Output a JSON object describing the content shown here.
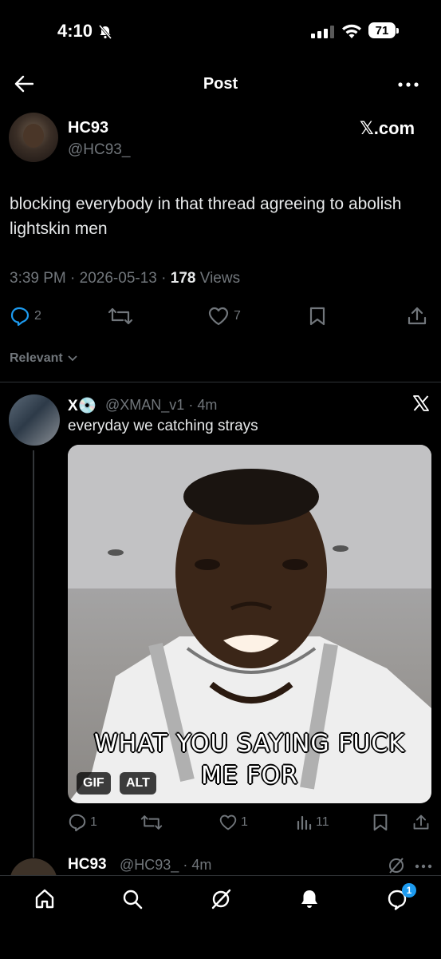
{
  "status_bar": {
    "time": "4:10",
    "battery": "71"
  },
  "header": {
    "title": "Post"
  },
  "post": {
    "author_name": "HC93",
    "author_handle": "@HC93_",
    "source_label": "𝕏.com",
    "text": "blocking everybody in that thread agreeing to abolish lightskin men",
    "time": "3:39 PM",
    "date": "2026-05-13",
    "views_count": "178",
    "views_label": "Views",
    "replies": "2",
    "likes": "7"
  },
  "sort_label": "Relevant",
  "reply": {
    "author_name": "X💿",
    "author_handle": "@XMAN_v1",
    "time": "4m",
    "text": "everyday we catching strays",
    "meme_line1": "WHAT YOU SAYING FUCK",
    "meme_line2": "ME FOR",
    "gif_label": "GIF",
    "alt_label": "ALT",
    "replies": "1",
    "likes": "1",
    "views": "11"
  },
  "next_reply": {
    "author_name": "HC93",
    "author_handle": "@HC93_",
    "time": "4m"
  },
  "nav": {
    "messages_badge": "1"
  },
  "colors": {
    "accent": "#1d9bf0",
    "muted": "#71767b",
    "background": "#000000"
  }
}
